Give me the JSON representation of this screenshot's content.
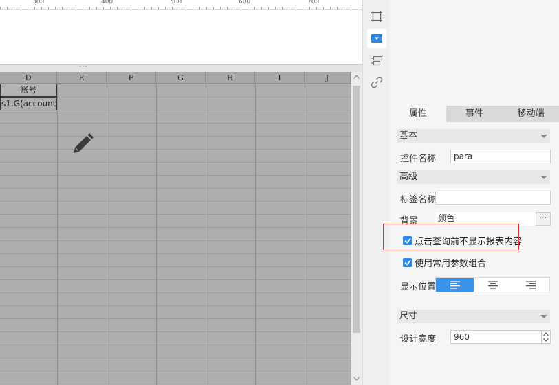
{
  "ruler": {
    "labels": [
      "300",
      "400",
      "500",
      "600",
      "700"
    ]
  },
  "splitter": {
    "grip": "···"
  },
  "sheet": {
    "columns": [
      "D",
      "E",
      "F",
      "G",
      "H",
      "I",
      "J"
    ],
    "cell_header": "账号",
    "cell_formula": "s1.G(account)"
  },
  "tools": [
    "crop-icon",
    "dropdown-widget-icon",
    "label-widget-icon",
    "link-icon"
  ],
  "panel": {
    "tabs": [
      "属性",
      "事件",
      "移动端"
    ],
    "active_tab": "属性",
    "section_basic": "基本",
    "widget_name_label": "控件名称",
    "widget_name_value": "para",
    "section_advanced": "高级",
    "tag_name_label": "标签名称",
    "tag_name_value": "",
    "background_label": "背景",
    "background_value": "颜色",
    "background_more": "···",
    "checkbox_hide_before_query": "点击查询前不显示报表内容",
    "checkbox_use_common_params": "使用常用参数组合",
    "display_position_label": "显示位置",
    "display_position_selected": "left",
    "section_size": "尺寸",
    "design_width_label": "设计宽度",
    "design_width_value": "960"
  },
  "colors": {
    "accent": "#2f86de",
    "highlight_border": "#e1322b",
    "sheet_bg": "#aeaeae"
  }
}
